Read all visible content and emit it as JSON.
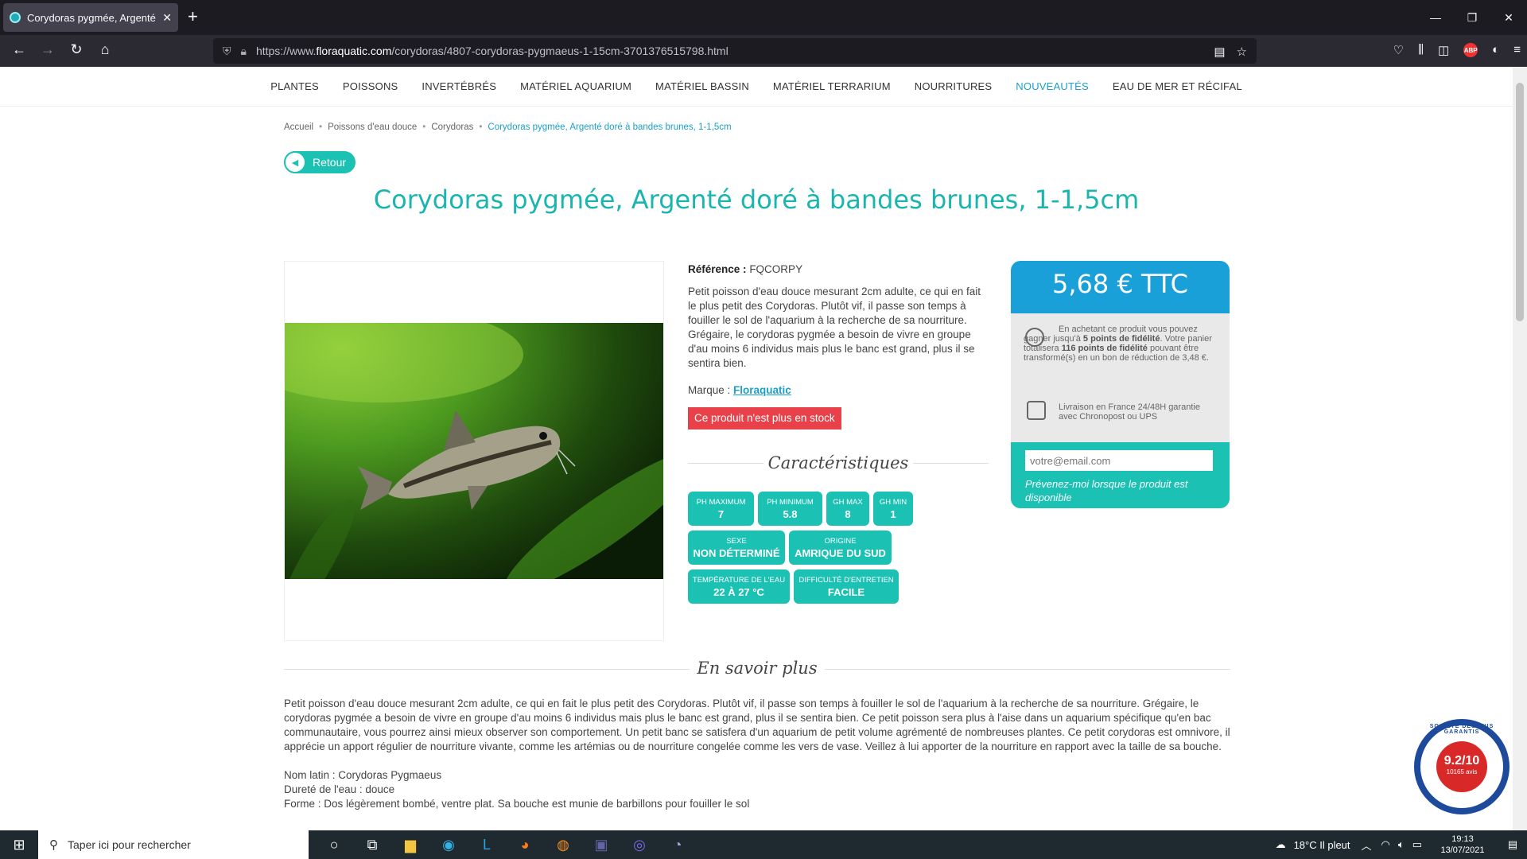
{
  "browser": {
    "tab_title": "Corydoras pygmée, Argenté do",
    "url_prefix": "https://www.",
    "url_host": "floraquatic.com",
    "url_rest": "/corydoras/4807-corydoras-pygmaeus-1-15cm-3701376515798.html"
  },
  "menu": {
    "items": [
      "PLANTES",
      "POISSONS",
      "INVERTÉBRÉS",
      "MATÉRIEL AQUARIUM",
      "MATÉRIEL BASSIN",
      "MATÉRIEL TERRARIUM",
      "NOURRITURES",
      "NOUVEAUTÉS",
      "EAU DE MER ET RÉCIFAL"
    ]
  },
  "breadcrumb": {
    "items": [
      "Accueil",
      "Poissons d'eau douce",
      "Corydoras",
      "Corydoras pygmée, Argenté doré à bandes brunes, 1-1,5cm"
    ]
  },
  "back_label": "Retour",
  "product": {
    "title": "Corydoras pygmée, Argenté doré à bandes brunes, 1-1,5cm",
    "reference_label": "Référence :",
    "reference": "FQCORPY",
    "short_desc": "Petit poisson d'eau douce mesurant 2cm adulte, ce qui en fait le plus petit des Corydoras. Plutôt vif, il passe son temps à fouiller le sol de l'aquarium à la recherche de sa nourriture. Grégaire, le corydoras pygmée a besoin de vivre en groupe d'au moins 6 individus mais plus le banc est grand, plus il se sentira bien.",
    "brand_label": "Marque :",
    "brand": "Floraquatic",
    "stock": "Ce produit n'est plus en stock"
  },
  "characteristics": {
    "heading": "Caractéristiques",
    "chips": [
      {
        "label": "PH MAXIMUM",
        "value": "7"
      },
      {
        "label": "PH MINIMUM",
        "value": "5.8"
      },
      {
        "label": "GH MAX",
        "value": "8"
      },
      {
        "label": "GH MIN",
        "value": "1"
      },
      {
        "label": "SEXE",
        "value": "NON DÉTERMINÉ"
      },
      {
        "label": "ORIGINE",
        "value": "AMRIQUE DU SUD"
      },
      {
        "label": "TEMPÉRATURE DE L'EAU",
        "value": "22 À 27 °C"
      },
      {
        "label": "DIFFICULTÉ D'ENTRETIEN",
        "value": "FACILE"
      }
    ]
  },
  "pricebox": {
    "price": "5,68 € TTC",
    "loyalty_a": "En achetant ce produit vous pouvez gagner jusqu'à ",
    "loyalty_b": "5 points de fidélité",
    "loyalty_c": ". Votre panier totalisera ",
    "loyalty_d": "116 points de fidélité",
    "loyalty_e": " pouvant être transformé(s) en un bon de réduction de 3,48 €.",
    "delivery": "Livraison en France 24/48H garantie avec Chronopost ou UPS",
    "email_placeholder": "votre@email.com",
    "notify_msg": "Prévenez-moi lorsque le produit est disponible"
  },
  "more": {
    "heading": "En savoir plus",
    "para": "Petit poisson d'eau douce mesurant 2cm adulte, ce qui en fait le plus petit des Corydoras. Plutôt vif, il passe son temps à fouiller le sol de l'aquarium à la recherche de sa nourriture. Grégaire, le corydoras pygmée a besoin de vivre en groupe d'au moins 6 individus mais plus le banc est grand, plus il se sentira bien. Ce petit poisson sera plus à l'aise dans un aquarium spécifique qu'en bac communautaire, vous pourrez ainsi mieux observer son comportement. Un petit banc se satisfera d'un aquarium de petit volume agrémenté de nombreuses plantes. Ce petit corydoras est omnivore, il apprécie un apport régulier de nourriture vivante, comme les artémias ou de nourriture congelée comme les vers de vase. Veillez à lui apporter de la nourriture en rapport avec la taille de sa bouche.",
    "latin": "Nom latin : Corydoras Pygmaeus",
    "hardness": "Dureté de l'eau : douce",
    "shape": "Forme : Dos légèrement bombé, ventre plat. Sa bouche est munie de barbillons pour fouiller le sol"
  },
  "badge": {
    "score": "9.2/10",
    "avis": "10165 avis",
    "ring": "SOCIÉTÉ DES AVIS GARANTIS"
  },
  "taskbar": {
    "search": "Taper ici pour rechercher",
    "weather": "18°C  Il pleut",
    "time": "19:13",
    "date": "13/07/2021"
  }
}
